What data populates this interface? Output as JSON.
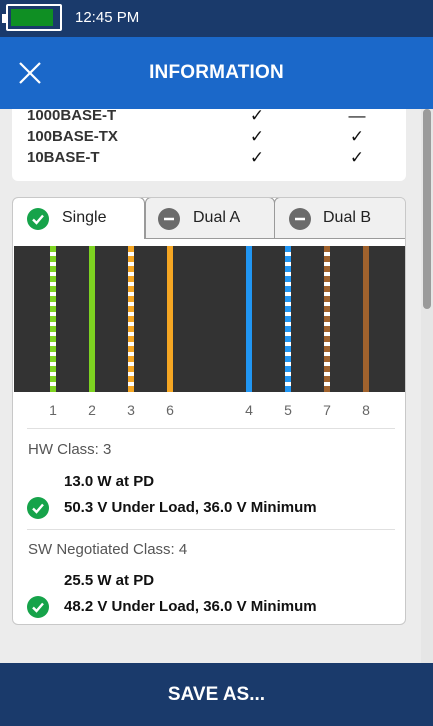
{
  "status_bar": {
    "time": "12:45 PM",
    "battery_color": "#0f8f23"
  },
  "header": {
    "title": "INFORMATION",
    "close_icon": "close-icon",
    "background": "#1b68c9"
  },
  "speeds": [
    {
      "name": "1000BASE-T",
      "col1": "✓",
      "col2": "—"
    },
    {
      "name": "100BASE-TX",
      "col1": "✓",
      "col2": "✓"
    },
    {
      "name": "10BASE-T",
      "col1": "✓",
      "col2": "✓"
    }
  ],
  "tabs": [
    {
      "label": "Single",
      "icon": "check-circle-icon",
      "active": true
    },
    {
      "label": "Dual A",
      "icon": "minus-circle-icon",
      "active": false
    },
    {
      "label": "Dual B",
      "icon": "minus-circle-icon",
      "active": false
    }
  ],
  "wires": [
    {
      "pin": "1",
      "color": "#7ed321",
      "striped": true
    },
    {
      "pin": "2",
      "color": "#7ed321",
      "striped": false
    },
    {
      "pin": "3",
      "color": "#f5a623",
      "striped": true
    },
    {
      "pin": "6",
      "color": "#f5a623",
      "striped": false
    },
    {
      "pin": "4",
      "color": "#2196f3",
      "striped": false
    },
    {
      "pin": "5",
      "color": "#2196f3",
      "striped": true
    },
    {
      "pin": "7",
      "color": "#a0622d",
      "striped": true
    },
    {
      "pin": "8",
      "color": "#a0622d",
      "striped": false
    }
  ],
  "hw_class": {
    "label": "HW Class: 3",
    "power": "13.0 W at PD",
    "voltage": "50.3 V Under Load, 36.0 V Minimum"
  },
  "sw_class": {
    "label": "SW Negotiated Class: 4",
    "power": "25.5 W at PD",
    "voltage": "48.2 V Under Load, 36.0 V Minimum"
  },
  "footer": {
    "label": "SAVE AS..."
  }
}
